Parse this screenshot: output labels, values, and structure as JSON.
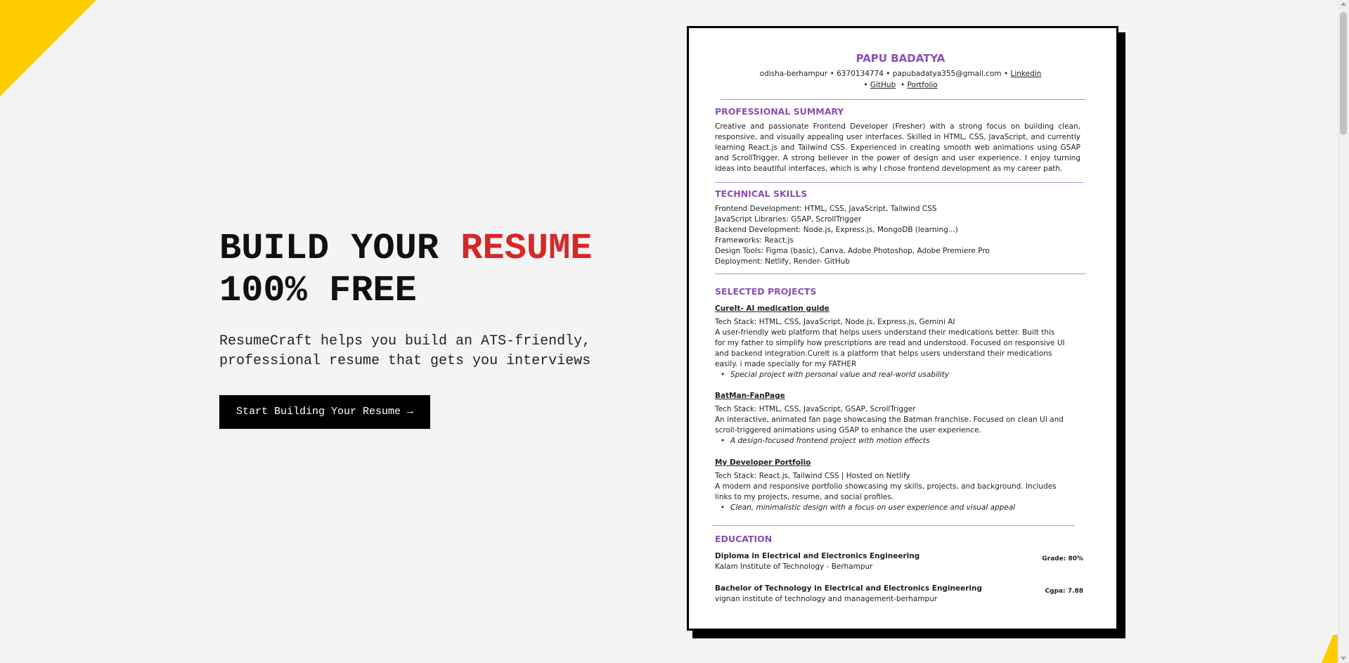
{
  "hero": {
    "heading_part1": "BUILD YOUR ",
    "heading_accent": "RESUME",
    "heading_line2": "100% FREE",
    "subtitle": "ResumeCraft helps you build an ATS-friendly, professional resume that gets you interviews",
    "cta_label": "Start Building Your Resume →"
  },
  "resume": {
    "name": "PAPU BADATYA",
    "contact_line1_text": "odisha-berhampur • 6370134774 • papubadatya355@gmail.com • ",
    "contact_linkedin": "Linkedin",
    "contact_bullet1": "• ",
    "contact_github": "GitHub",
    "contact_bullet2": "  • ",
    "contact_portfolio": "Portfolio",
    "summary_title": "PROFESSIONAL SUMMARY",
    "summary_text": "Creative and passionate Frontend Developer (Fresher) with a strong focus on building clean, responsive, and visually appealing user interfaces. Skilled in HTML, CSS, JavaScript, and currently learning React.js and Tailwind CSS. Experienced in creating smooth web animations using GSAP and ScrollTrigger. A strong believer in the power of design and user experience. I enjoy turning ideas into beautiful interfaces, which is why I chose frontend development as my career path.",
    "skills_title": "TECHNICAL SKILLS",
    "skills": [
      "Frontend Development: HTML, CSS, JavaScript, Tailwind CSS",
      "JavaScript Libraries: GSAP, ScrollTrigger",
      "Backend Development: Node.js, Express.js, MongoDB (learning...)",
      "Frameworks: React.js",
      "Design Tools: Figma (basic), Canva, Adobe Photoshop, Adobe Premiere Pro",
      "Deployment: Netlify, Render- GitHub"
    ],
    "projects_title": "SELECTED PROJECTS",
    "projects": [
      {
        "title": "CureIt- AI medication guide",
        "stack": "Tech Stack: HTML, CSS, JavaScript, Node.js, Express.js, Gemini AI",
        "desc": " A user-friendly web platform that helps users understand their medications better. Built this for my father to simplify how prescriptions are read and understood. Focused on responsive UI and backend integration.CureIt is a platform that helps users understand their medications easily. i made specially for my FATHER",
        "bullet": "Special project with personal value and real-world usability"
      },
      {
        "title": "BatMan-FanPage",
        "stack": "Tech Stack: HTML, CSS, JavaScript, GSAP, ScrollTrigger",
        "desc": " An interactive, animated fan page showcasing the Batman franchise. Focused on clean UI and scroll-triggered animations using GSAP to enhance the user experience.",
        "bullet": "A design-focused frontend project with motion effects"
      },
      {
        "title": "My Developer Portfolio",
        "stack": "Tech Stack: React.js, Tailwind CSS | Hosted on Netlify",
        "desc": " A modern and responsive portfolio showcasing my skills, projects, and background. Includes links to my projects, resume, and social profiles.",
        "bullet": "Clean, minimalistic design with a focus on user experience and visual appeal"
      }
    ],
    "education_title": "EDUCATION",
    "education": [
      {
        "degree": "Diploma in Electrical and Electronics Engineering",
        "institute": "Kalam Institute of Technology - Berhampur",
        "grade": "Grade: 80%"
      },
      {
        "degree": "Bachelor of Technology in Electrical and Electronics Engineering",
        "institute": "vignan institute of technology and management-berhampur",
        "grade": "Cgpa: 7.88"
      }
    ]
  },
  "colors": {
    "accent_red": "#d62828",
    "resume_purple": "#8a4fb3",
    "corner_yellow": "#ffcc00"
  }
}
